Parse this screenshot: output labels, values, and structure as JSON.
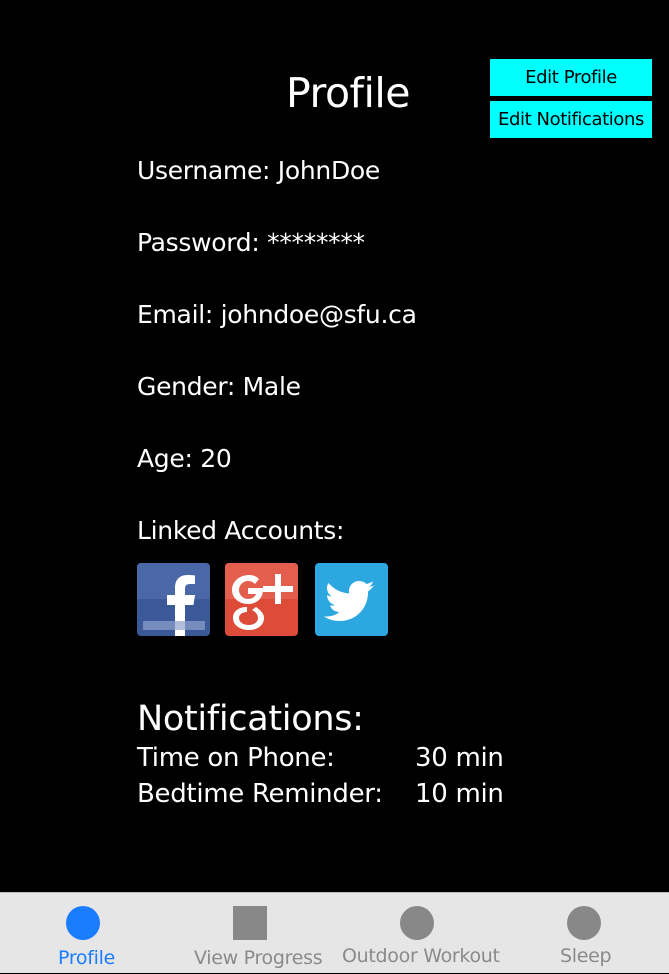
{
  "header": {
    "title": "Profile",
    "edit_profile_label": "Edit Profile",
    "edit_notifications_label": "Edit Notifications",
    "button_color": "#00ffff"
  },
  "profile": {
    "username": "Username: JohnDoe",
    "password": "Password: ********",
    "email": "Email: johndoe@sfu.ca",
    "gender": "Gender: Male",
    "age": "Age: 20"
  },
  "linked_accounts": {
    "label": "Linked Accounts:",
    "accounts": [
      {
        "icon": "facebook-icon",
        "color": "#3b5998"
      },
      {
        "icon": "google-plus-icon",
        "color": "#dd4b39"
      },
      {
        "icon": "twitter-icon",
        "color": "#2ca7e0"
      }
    ]
  },
  "notifications": {
    "heading": "Notifications:",
    "items": [
      {
        "label": "Time on Phone:",
        "value": "30 min"
      },
      {
        "label": "Bedtime Reminder:",
        "value": "10 min"
      }
    ]
  },
  "tabbar": {
    "active_color": "#1a7cff",
    "inactive_color": "#888888",
    "tabs": [
      {
        "label": "Profile",
        "icon": "profile-circle-icon",
        "active": true
      },
      {
        "label": "View Progress",
        "icon": "progress-square-icon",
        "active": false
      },
      {
        "label": "Outdoor Workout",
        "icon": "outdoor-circle-icon",
        "active": false
      },
      {
        "label": "Sleep",
        "icon": "sleep-circle-icon",
        "active": false
      }
    ]
  }
}
